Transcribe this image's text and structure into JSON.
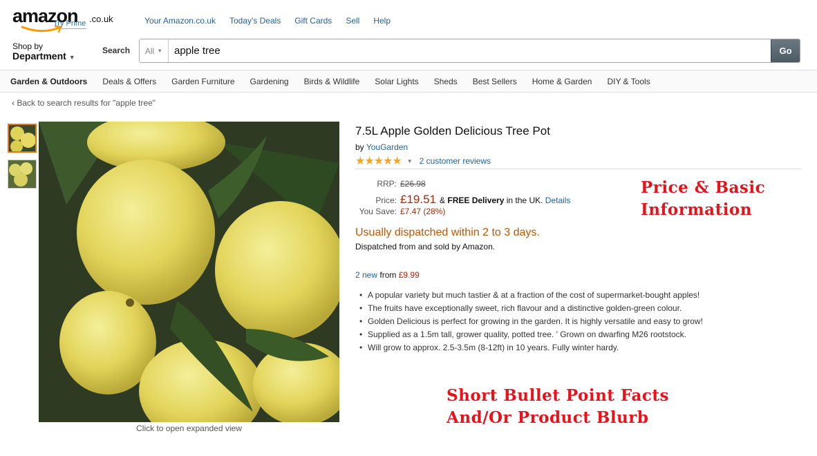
{
  "header": {
    "logo_text": "amazon",
    "logo_tld": ".co.uk",
    "try_prime": "Try Prime",
    "top_nav": [
      "Your Amazon.co.uk",
      "Today's Deals",
      "Gift Cards",
      "Sell",
      "Help"
    ],
    "shop_by_line1": "Shop by",
    "shop_by_line2": "Department",
    "search_label": "Search",
    "search_category": "All",
    "search_value": "apple tree",
    "go_label": "Go"
  },
  "sub_nav": [
    "Garden & Outdoors",
    "Deals & Offers",
    "Garden Furniture",
    "Gardening",
    "Birds & Wildlife",
    "Solar Lights",
    "Sheds",
    "Best Sellers",
    "Home & Garden",
    "DIY & Tools"
  ],
  "back_link": "‹ Back to search results for \"apple tree\"",
  "image_caption": "Click to open expanded view",
  "product": {
    "title": "7.5L Apple Golden Delicious Tree Pot",
    "by": "by",
    "brand": "YouGarden",
    "stars_display": "★★★★★",
    "reviews": "2 customer reviews",
    "rrp_label": "RRP:",
    "rrp_value": "£26.98",
    "price_label": "Price:",
    "price_value": "£19.51",
    "delivery_amp": "&",
    "delivery_bold": "FREE Delivery",
    "delivery_rest": "in the UK.",
    "details_link": "Details",
    "save_label": "You Save:",
    "save_value": "£7.47 (28%)",
    "dispatch": "Usually dispatched within 2 to 3 days.",
    "sold_by": "Dispatched from and sold by Amazon.",
    "new_link": "2 new",
    "new_from": "from",
    "new_price": "£9.99",
    "bullets": [
      "A popular variety but much tastier & at a fraction of the cost of supermarket-bought apples!",
      "The fruits have exceptionally sweet, rich flavour and a distinctive golden-green colour.",
      "Golden Delicious is perfect for growing in the garden. It is highly versatile and easy to grow!",
      "Supplied as a 1.5m tall, grower quality, potted tree. ' Grown on dwarfing M26 rootstock.",
      "Will grow to approx. 2.5-3.5m (8-12ft) in 10 years. Fully winter hardy."
    ]
  },
  "annotations": {
    "a1_line1": "Price & Basic",
    "a1_line2": "Information",
    "a2_line1": "Short Bullet Point Facts",
    "a2_line2": "And/Or Product Blurb"
  },
  "colors": {
    "link": "#2162a1",
    "price": "#b12704",
    "dispatch": "#c45500",
    "annotation": "#e8131a",
    "stars": "#f5a623"
  }
}
